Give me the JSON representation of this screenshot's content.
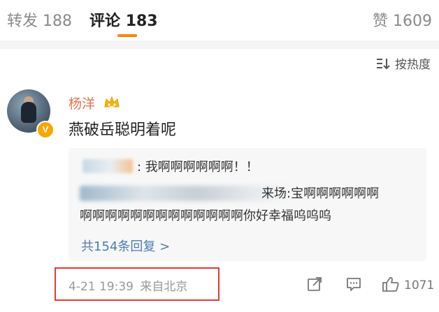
{
  "tabs": [
    {
      "label": "转发",
      "count": "188"
    },
    {
      "label": "评论",
      "count": "183"
    },
    {
      "label": "赞",
      "count": "1609"
    }
  ],
  "sort_label": "按热度",
  "comment": {
    "username": "杨洋",
    "text": "燕破岳聪明着呢",
    "vip_badge": "V",
    "date": "4-21 19:39",
    "location": "来自北京",
    "like_count": "1071"
  },
  "replies": [
    {
      "text": ": 我啊啊啊啊啊啊！！"
    },
    {
      "line1": "来场:宝啊啊啊啊啊啊",
      "line2": "啊啊啊啊啊啊啊啊啊啊啊啊啊你好幸福呜呜呜"
    }
  ],
  "more_replies": "共154条回复 >",
  "colors": {
    "accent": "#ff8200",
    "username": "#eb7350",
    "link": "#4b7bb7",
    "highlight_box": "#e53a2f"
  },
  "icons": [
    "sort-icon",
    "crown-icon",
    "share-icon",
    "comment-icon",
    "like-icon"
  ]
}
